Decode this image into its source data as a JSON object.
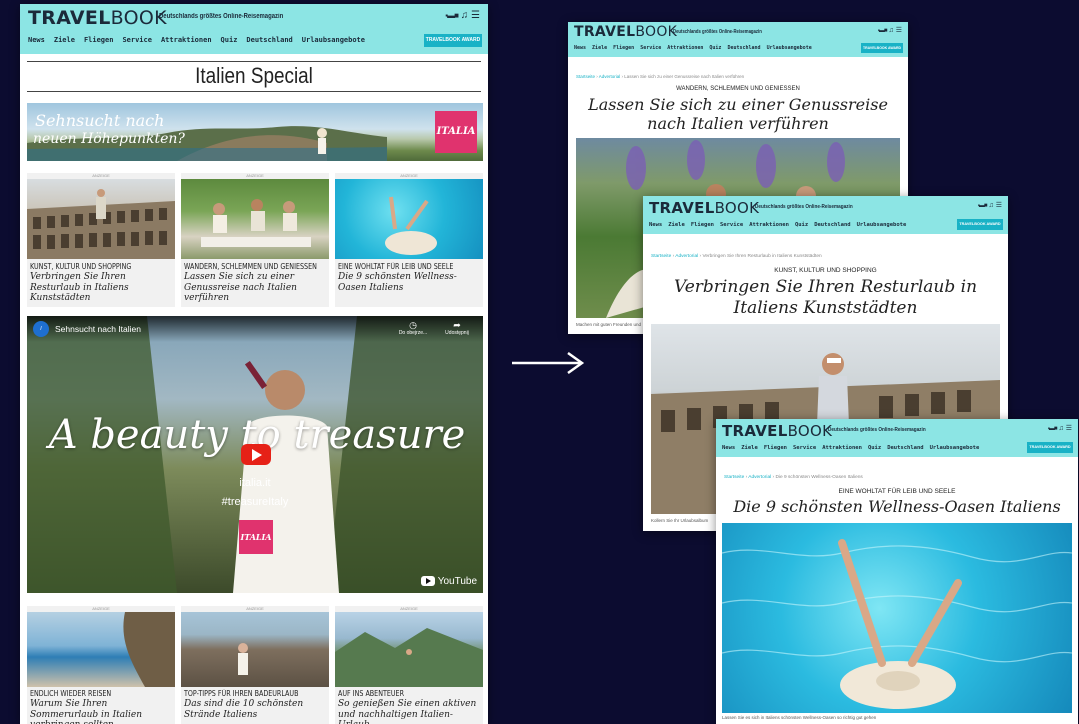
{
  "site": {
    "logo_bold": "TRAVEL",
    "logo_thin": "BOOK",
    "tagline": "Deutschlands größtes Online-Reisemagazin",
    "nav": [
      "News",
      "Ziele",
      "Fliegen",
      "Service",
      "Attraktionen",
      "Quiz",
      "Deutschland",
      "Urlaubsangebote"
    ],
    "award": "TRAVELBOOK AWARD",
    "icons": [
      "bild-icon",
      "bell-icon",
      "menu-icon"
    ]
  },
  "main": {
    "title": "Italien Special",
    "banner": {
      "script_line1": "Sehnsucht nach",
      "script_line2": "neuen Höhepunkten?",
      "brand": "ITALIA"
    },
    "ad_label": "ANZEIGE",
    "top_tiles": [
      {
        "kicker": "KUNST, KULTUR UND SHOPPING",
        "desc": "Verbringen Sie Ihren Resturlaub in Italiens Kunststädten"
      },
      {
        "kicker": "WANDERN, SCHLEMMEN UND GENIESSEN",
        "desc": "Lassen Sie sich zu einer Genussreise nach Italien verführen"
      },
      {
        "kicker": "EINE WOHLTAT FÜR LEIB UND SEELE",
        "desc": "Die 9 schönsten Wellness-Oasen Italiens"
      }
    ],
    "video": {
      "title": "Sehnsucht nach Italien",
      "watch_later": "Do obejrze...",
      "share": "Udostępnij",
      "script": "A beauty to treasure",
      "site": "italia.it",
      "hashtag": "#treasureItaly",
      "brand": "ITALIA",
      "youtube": "YouTube"
    },
    "bottom_tiles": [
      {
        "kicker": "ENDLICH WIEDER REISEN",
        "desc": "Warum Sie Ihren Sommerurlaub in Italien verbringen sollten"
      },
      {
        "kicker": "TOP-TIPPS FÜR IHREN BADEURLAUB",
        "desc": "Das sind die 10 schönsten Strände Italiens"
      },
      {
        "kicker": "AUF INS ABENTEUER",
        "desc": "So genießen Sie einen aktiven und nachhaltigen Italien-Urlaub"
      }
    ]
  },
  "article1": {
    "crumb_home": "Startseite",
    "crumb_sep": " › ",
    "crumb_section": "Advertorial",
    "crumb_current": "Lassen Sie sich zu einer Genussreise nach Italien verführen",
    "kicker": "WANDERN, SCHLEMMEN UND GENIESSEN",
    "title": "Lassen Sie sich zu einer Genussreise nach Italien verführen",
    "caption": "Machen mit guten Freunden und"
  },
  "article2": {
    "crumb_home": "Startseite",
    "crumb_sep": " › ",
    "crumb_section": "Advertorial",
    "crumb_current": "Verbringen Sie Ihren Resturlaub in Italiens Kunststädten",
    "kicker": "KUNST, KULTUR UND SHOPPING",
    "title": "Verbringen Sie Ihren Resturlaub in Italiens Kunststädten",
    "caption": "Kollern Sie Ihr Urlaubsalbum"
  },
  "article3": {
    "crumb_home": "Startseite",
    "crumb_sep": " › ",
    "crumb_section": "Advertorial",
    "crumb_current": "Die 9 schönsten Wellness-Oasen Italiens",
    "kicker": "EINE WOHLTAT FÜR LEIB UND SEELE",
    "title": "Die 9 schönsten Wellness-Oasen Italiens",
    "caption": "Lassen Sie es sich in Italiens schönsten Wellness-Oasen so richtig gut gehen"
  },
  "colors": {
    "header": "#8ce5e4",
    "accent": "#19b2c6",
    "brand_pink": "#e0336e",
    "background": "#0c0c30"
  }
}
